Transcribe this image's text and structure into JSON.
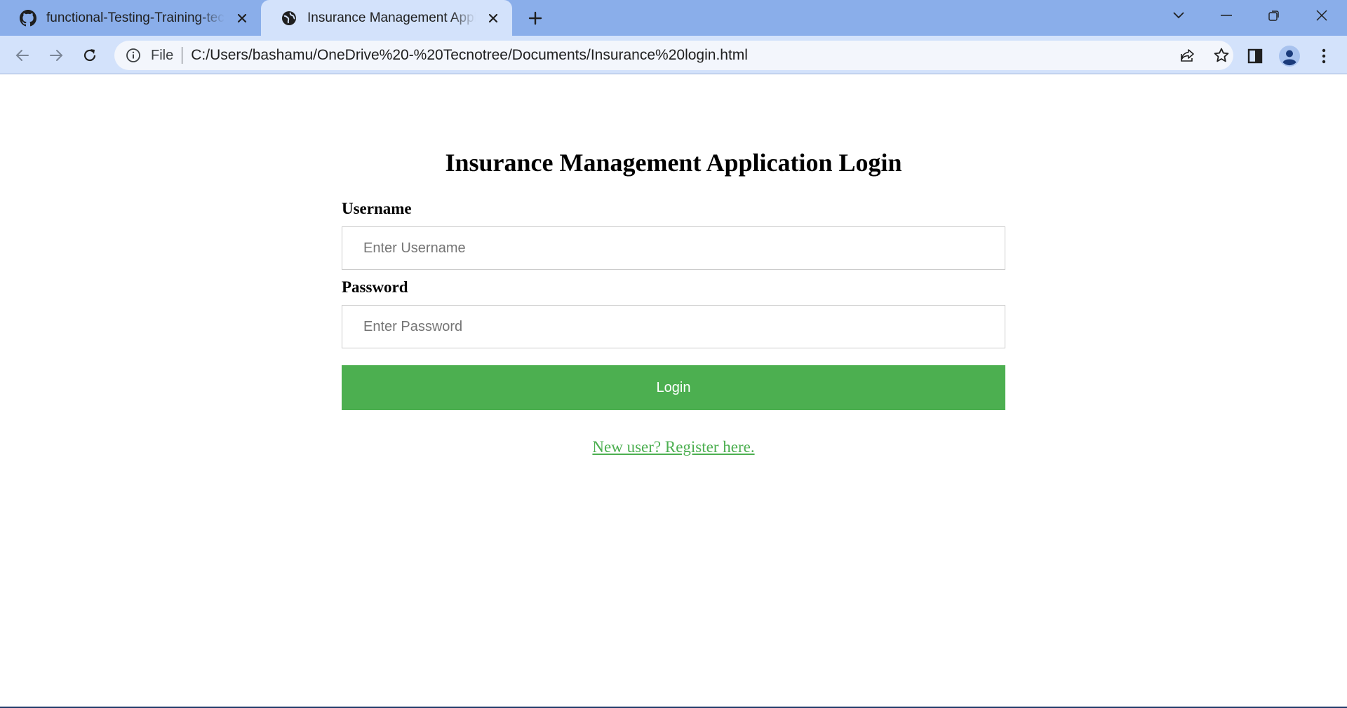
{
  "browser": {
    "tabs": [
      {
        "title": "functional-Testing-Training-tecnotree",
        "icon": "github-icon",
        "active": false
      },
      {
        "title": "Insurance Management Application Login",
        "icon": "globe-icon",
        "active": true
      }
    ],
    "address": {
      "scheme_label": "File",
      "url": "C:/Users/bashamu/OneDrive%20-%20Tecnotree/Documents/Insurance%20login.html"
    },
    "colors": {
      "tabstrip": "#8aaeea",
      "toolbar": "#d3e2fb"
    }
  },
  "page": {
    "title": "Insurance Management Application Login",
    "username": {
      "label": "Username",
      "placeholder": "Enter Username",
      "value": ""
    },
    "password": {
      "label": "Password",
      "placeholder": "Enter Password",
      "value": ""
    },
    "login_button": "Login",
    "register_link": "New user? Register here.",
    "colors": {
      "accent": "#4caf50"
    }
  }
}
